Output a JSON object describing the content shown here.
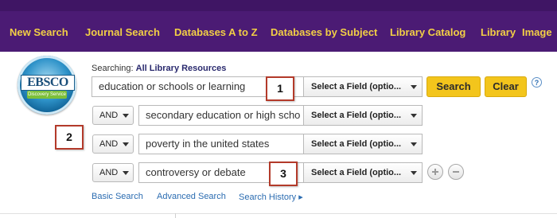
{
  "nav": {
    "items": [
      "New Search",
      "Journal Search",
      "Databases A to Z",
      "Databases by Subject",
      "Library Catalog",
      "Library",
      "Image"
    ]
  },
  "logo": {
    "brand": "EBSCO",
    "sub": "Discovery Service"
  },
  "searching": {
    "label": "Searching:",
    "scope": "All Library Resources"
  },
  "rows": [
    {
      "term": "education or schools or learning",
      "field": "Select a Field (optio..."
    },
    {
      "bool": "AND",
      "term": "secondary education or high scho",
      "field": "Select a Field (optio..."
    },
    {
      "bool": "AND",
      "term": "poverty in the united states",
      "field": "Select a Field (optio..."
    },
    {
      "bool": "AND",
      "term": "controversy or debate",
      "field": "Select a Field (optio..."
    }
  ],
  "buttons": {
    "search": "Search",
    "clear": "Clear",
    "help": "?"
  },
  "callouts": [
    "1",
    "2",
    "3"
  ],
  "links": {
    "basic": "Basic Search",
    "advanced": "Advanced Search",
    "history": "Search History ▸"
  },
  "colors": {
    "header": "#4b1b74",
    "nav_text": "#f2cf45",
    "button": "#f3c51c",
    "link": "#2b6cb1",
    "callout_border": "#b33a2a"
  }
}
